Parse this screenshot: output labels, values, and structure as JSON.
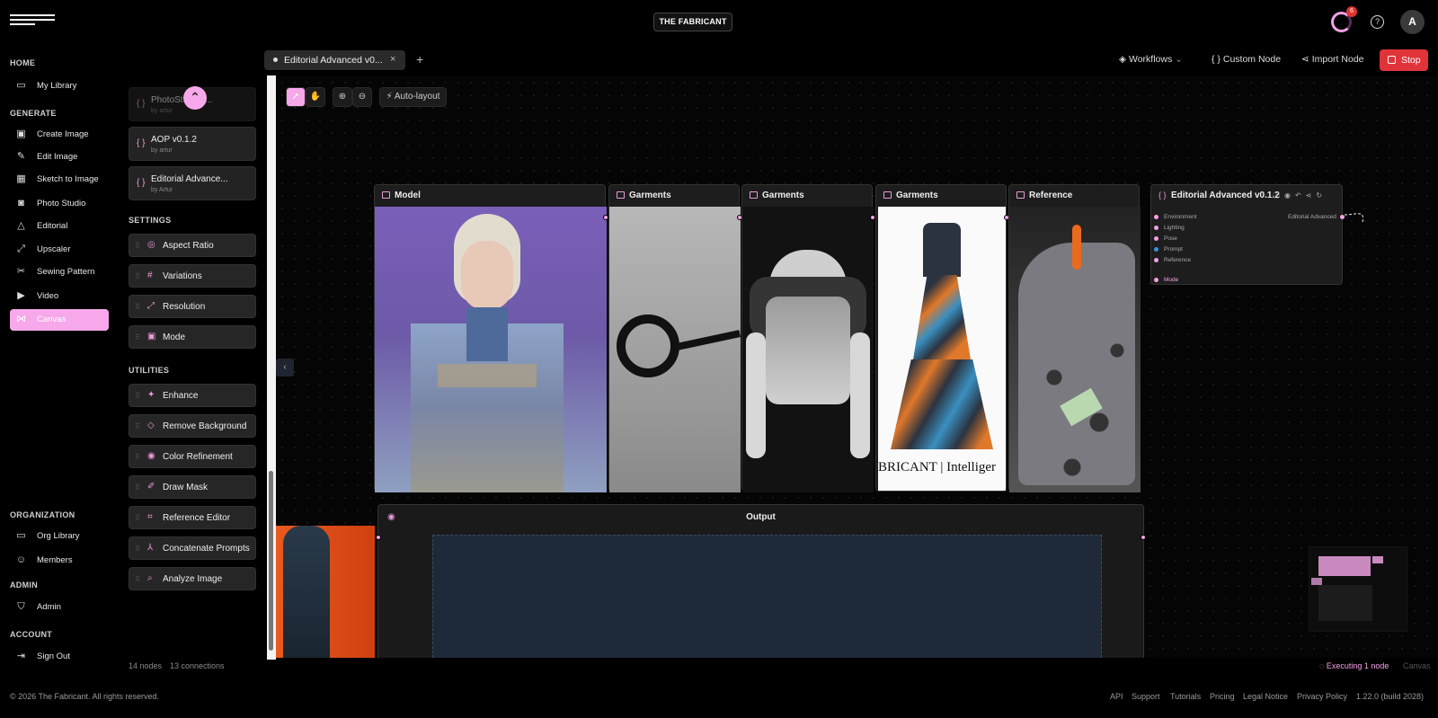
{
  "brand": {
    "pill": "THE FABRICANT"
  },
  "notifications": {
    "count": "6"
  },
  "user": {
    "avatar_initial": "A"
  },
  "nav": {
    "home_label": "HOME",
    "my_library": "My Library",
    "generate_label": "GENERATE",
    "generate_items": [
      "Create Image",
      "Edit Image",
      "Sketch to Image",
      "Photo Studio",
      "Editorial",
      "Upscaler",
      "Sewing Pattern",
      "Video",
      "Canvas"
    ],
    "organization_label": "ORGANIZATION",
    "org_library": "Org Library",
    "members": "Members",
    "admin_label": "ADMIN",
    "admin": "Admin",
    "account_label": "ACCOUNT",
    "sign_out": "Sign Out"
  },
  "palette": {
    "workflows": [
      {
        "title": "PhotoSt...apir...",
        "author": "by artur"
      },
      {
        "title": "AOP v0.1.2",
        "author": "by artur"
      },
      {
        "title": "Editorial Advance...",
        "author": "by Artur"
      }
    ],
    "settings_label": "SETTINGS",
    "settings": [
      "Aspect Ratio",
      "Variations",
      "Resolution",
      "Mode"
    ],
    "utilities_label": "UTILITIES",
    "utilities": [
      "Enhance",
      "Remove Background",
      "Color Refinement",
      "Draw Mask",
      "Reference Editor",
      "Concatenate Prompts",
      "Analyze Image"
    ]
  },
  "tabs": {
    "active": "Editorial Advanced v0...",
    "close": "×",
    "add": "+"
  },
  "actions": {
    "workflows": "Workflows",
    "custom_node": "Custom Node",
    "import_node": "Import Node",
    "stop": "Stop"
  },
  "toolbar": {
    "auto_layout": "Auto-layout"
  },
  "nodes": {
    "model": "Model",
    "garments1": "Garments",
    "garments2": "Garments",
    "garments3": "Garments",
    "reference": "Reference",
    "editorial": "Editorial Advanced v0.1.2",
    "editorial_inputs": [
      "Environment",
      "Lighting",
      "Pose",
      "Prompt",
      "Reference"
    ],
    "editorial_output": "Editorial Advanced",
    "editorial_mode": "Mode",
    "output": "Output",
    "dress_caption": "BRICANT | Intelliger"
  },
  "status": {
    "nodes": "14 nodes",
    "connections": "13 connections",
    "executing": "Executing 1 node",
    "mode": "Canvas"
  },
  "footer": {
    "copyright": "© 2026 The Fabricant. All rights reserved.",
    "links": [
      "API",
      "Support",
      "Tutorials",
      "Pricing",
      "Legal Notice",
      "Privacy Policy"
    ],
    "version": "1.22.0 (build 2028)"
  }
}
